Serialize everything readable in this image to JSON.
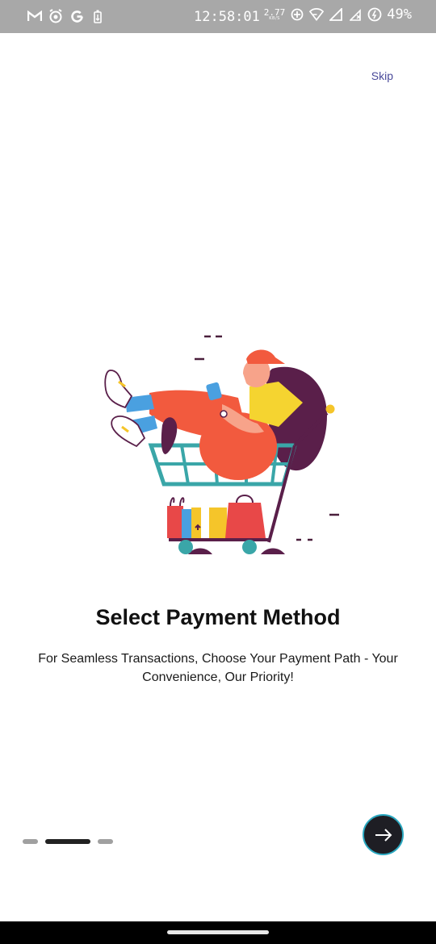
{
  "status_bar": {
    "time": "12:58:01",
    "net_speed_value": "2.77",
    "net_speed_unit": "KB/S",
    "battery_percent": "49%",
    "left_icons": [
      "gmail-icon",
      "alarm-icon",
      "google-icon",
      "battery-saver-icon"
    ],
    "right_icons": [
      "data-saver-icon",
      "wifi-icon",
      "signal-icon",
      "no-signal-icon",
      "battery-icon"
    ]
  },
  "header": {
    "skip_label": "Skip"
  },
  "onboarding": {
    "title": "Select Payment Method",
    "subtitle": "For Seamless Transactions, Choose Your Payment Path - Your Convenience, Our Priority!",
    "illustration_icon": "shopping-cart-girl-illustration",
    "total_pages": 3,
    "current_page": 2,
    "next_icon": "arrow-right-icon"
  },
  "colors": {
    "status_bar_bg": "#a8a8a8",
    "accent_ring": "#2aa8c0",
    "button_bg": "#1e1e24",
    "skip_text": "#4a4a9a",
    "active_dot": "#222222",
    "inactive_dot": "#a0a0a0"
  }
}
